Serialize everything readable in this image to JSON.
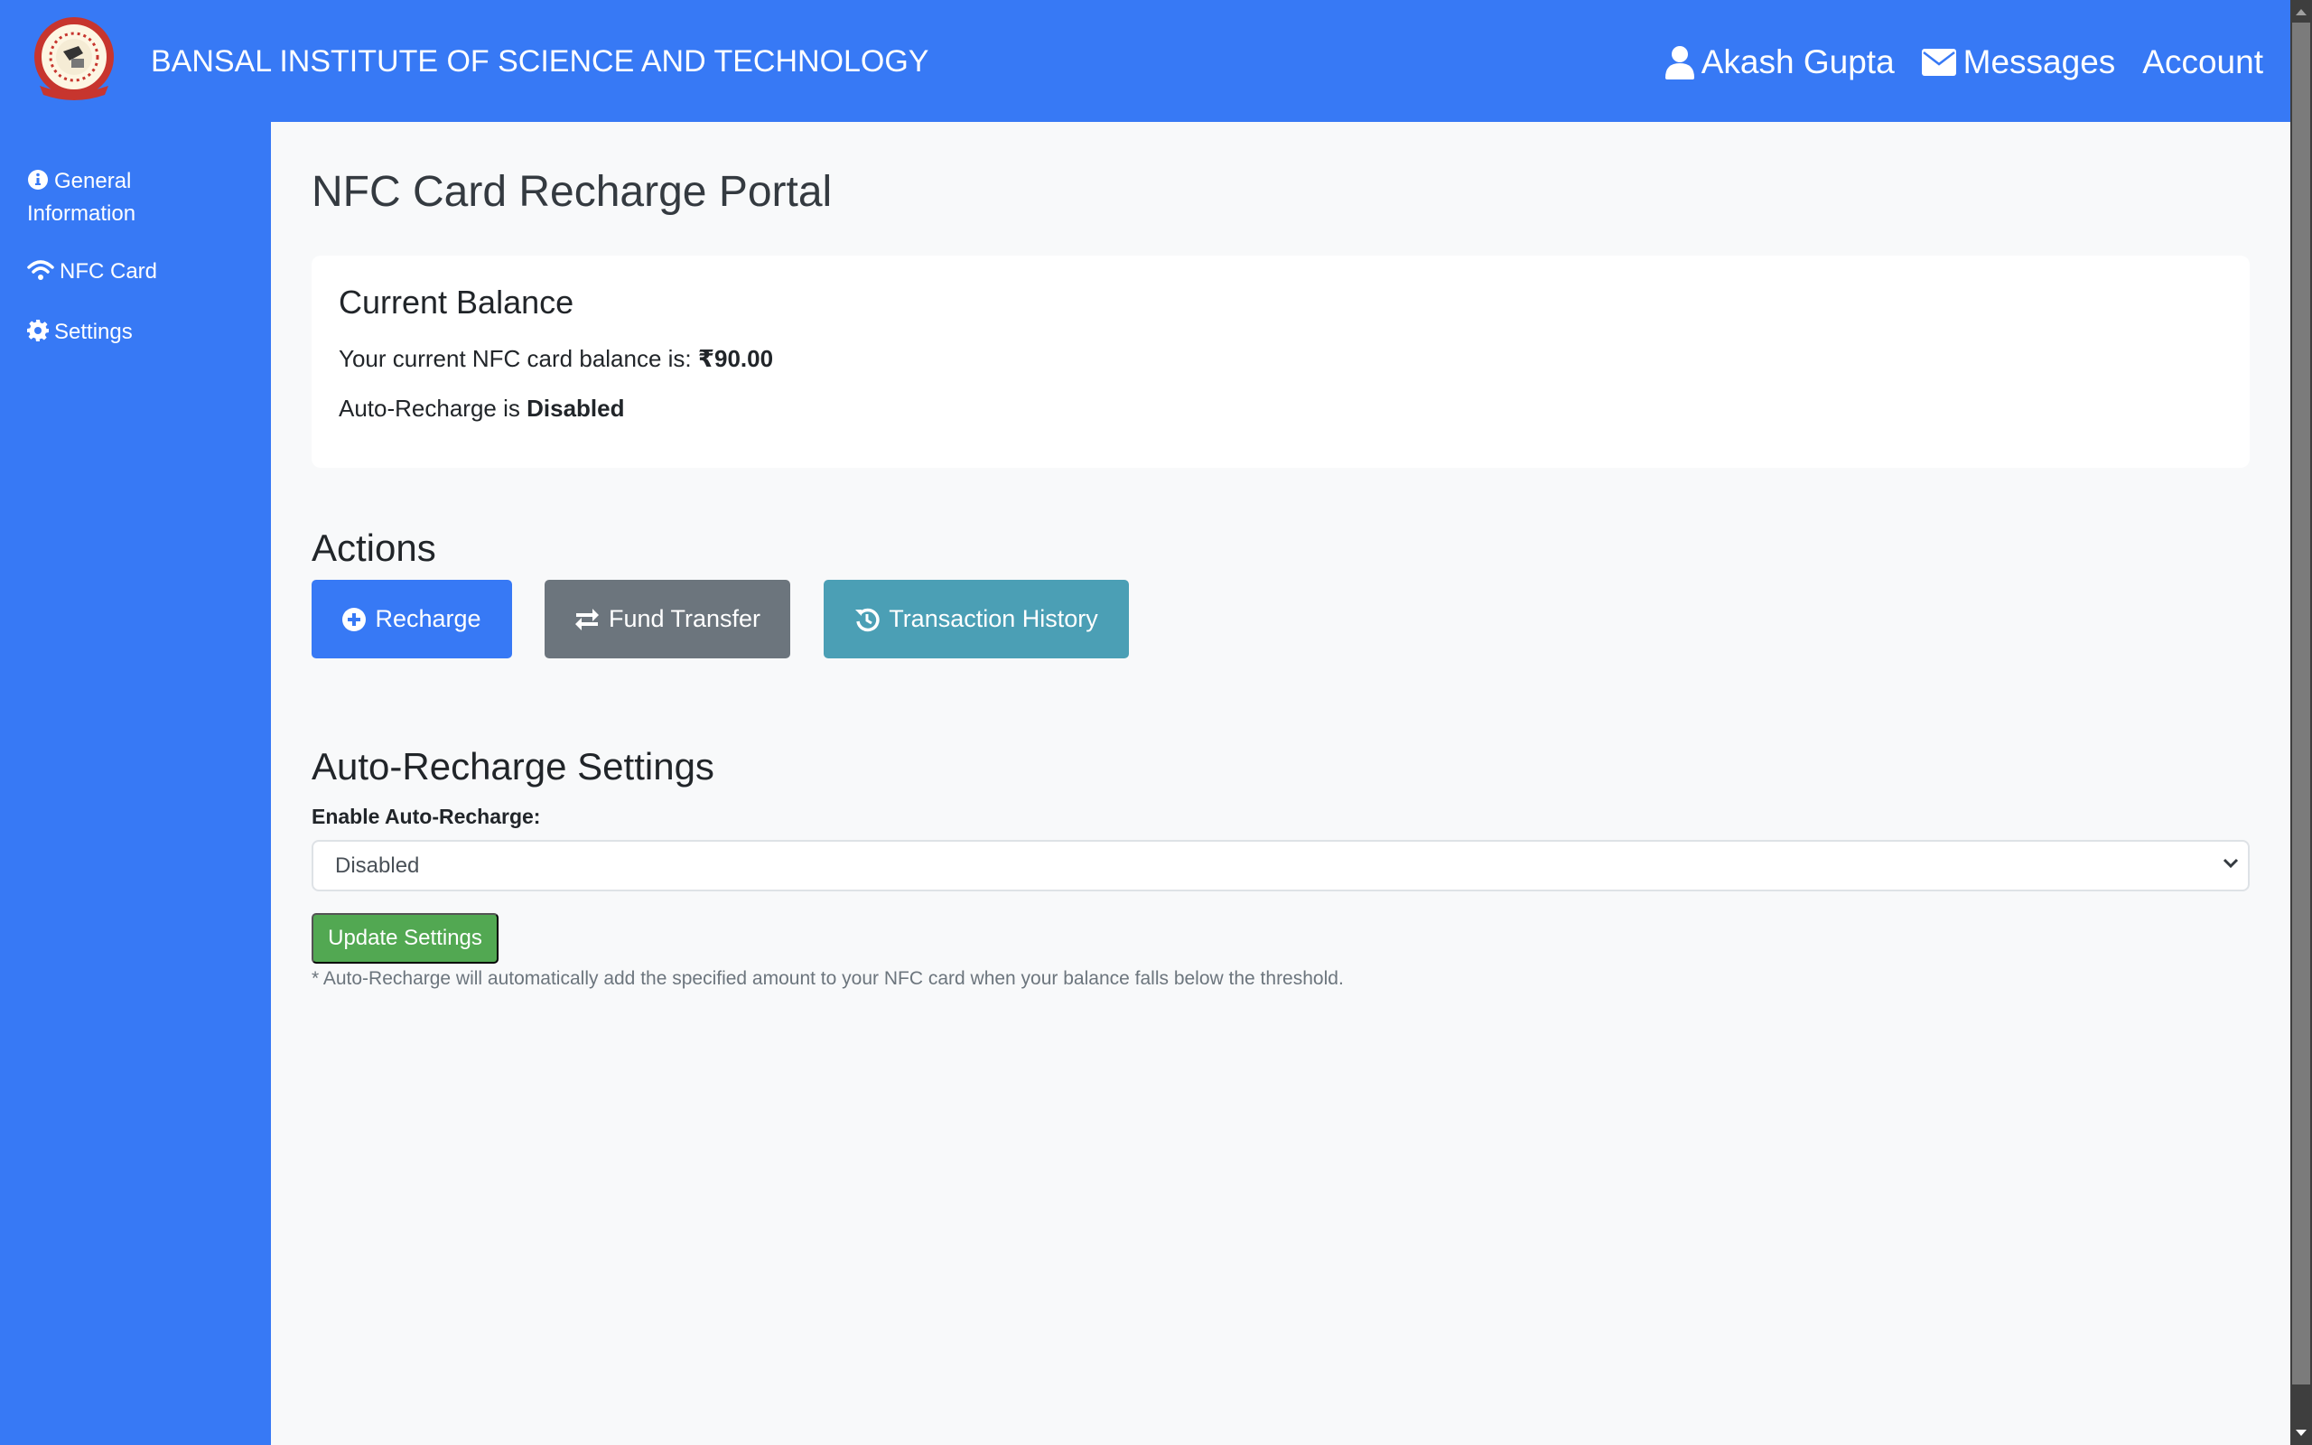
{
  "header": {
    "brand": "BANSAL INSTITUTE OF SCIENCE AND TECHNOLOGY",
    "logo_icon": "institute-logo",
    "nav": [
      {
        "label": "Akash Gupta",
        "icon": "user-icon"
      },
      {
        "label": "Messages",
        "icon": "envelope-icon"
      },
      {
        "label": "Account",
        "icon": ""
      }
    ]
  },
  "sidebar": {
    "items": [
      {
        "label": "General Information",
        "icon": "info-circle-icon"
      },
      {
        "label": "NFC Card",
        "icon": "wifi-icon"
      },
      {
        "label": "Settings",
        "icon": "gear-icon"
      }
    ]
  },
  "main": {
    "title": "NFC Card Recharge Portal",
    "balance_card": {
      "heading": "Current Balance",
      "balance_prefix": "Your current NFC card balance is: ",
      "balance_value": "₹90.00",
      "auto_prefix": "Auto-Recharge is ",
      "auto_status": "Disabled"
    },
    "actions": {
      "heading": "Actions",
      "buttons": [
        {
          "label": "Recharge",
          "icon": "plus-circle-icon"
        },
        {
          "label": "Fund Transfer",
          "icon": "exchange-icon"
        },
        {
          "label": "Transaction History",
          "icon": "history-icon"
        }
      ]
    },
    "auto_recharge": {
      "heading": "Auto-Recharge Settings",
      "label": "Enable Auto-Recharge:",
      "select_value": "Disabled",
      "update_label": "Update Settings",
      "footnote": "* Auto-Recharge will automatically add the specified amount to your NFC card when your balance falls below the threshold."
    }
  },
  "colors": {
    "primary": "#3779f5",
    "secondary": "#6c757d",
    "info": "#4b9fb5",
    "success": "#52a852",
    "background": "#f8f9fa"
  }
}
